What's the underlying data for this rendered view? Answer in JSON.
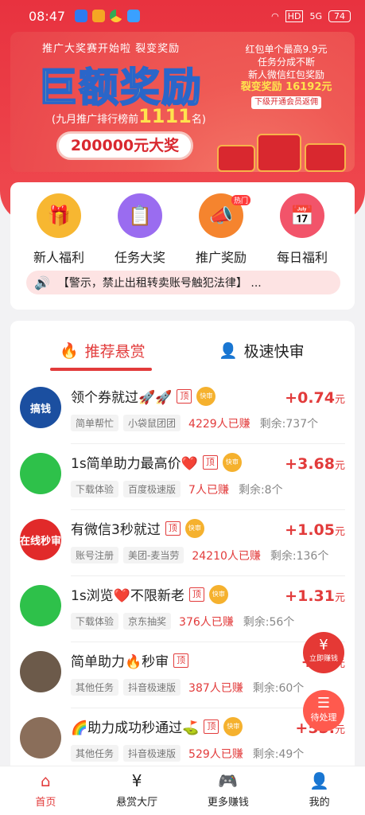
{
  "status": {
    "time": "08:47",
    "icons": [
      "baidu-icon",
      "app-icon",
      "chrome-icon",
      "app2-icon"
    ],
    "battery": "74",
    "hd": "HD",
    "signal": "5G"
  },
  "banner": {
    "promo_line": "推广大奖赛开始啦  裂变奖励",
    "big_title": "巨额奖励",
    "rank_prefix": "(九月推广排行榜前",
    "rank_number": "1111",
    "rank_suffix": "名)",
    "prize": "200000元大奖",
    "right_lines": [
      "红包单个最高9.9元",
      "任务分成不断",
      "新人微信红包奖励"
    ],
    "fission": "裂变奖励 16192元",
    "sub_button": "下级开通会员返佣"
  },
  "menu": {
    "items": [
      {
        "label": "新人福利",
        "icon": "gift-icon",
        "color": "#f7b731"
      },
      {
        "label": "任务大奖",
        "icon": "clipboard-icon",
        "color": "#9a6cf0"
      },
      {
        "label": "推广奖励",
        "icon": "megaphone-icon",
        "color": "#f5842e",
        "badge": "热门"
      },
      {
        "label": "每日福利",
        "icon": "calendar-check-icon",
        "color": "#f2546a"
      }
    ],
    "notice": "【警示，禁止出租转卖账号触犯法律】 ..."
  },
  "tabs": {
    "active": "推荐悬赏",
    "inactive": "极速快审"
  },
  "tasks": [
    {
      "title": "领个券就过🚀🚀",
      "top": "顶",
      "fast": "快审",
      "price_sign": "+",
      "price": "0.74",
      "unit": "元",
      "tags": [
        "简单帮忙",
        "小袋鼠团团"
      ],
      "earned": "4229人已赚",
      "remain": "剩余:737个",
      "avatar_color": "#1b4fa0",
      "avatar_text": "搞钱"
    },
    {
      "title": "1s简单助力最高价❤️",
      "top": "顶",
      "fast": "快审",
      "price_sign": "+",
      "price": "3.68",
      "unit": "元",
      "tags": [
        "下载体验",
        "百度极速版"
      ],
      "earned": "7人已赚",
      "remain": "剩余:8个",
      "avatar_color": "#2ec14a",
      "avatar_text": ""
    },
    {
      "title": "有微信3秒就过",
      "top": "顶",
      "fast": "快审",
      "price_sign": "+",
      "price": "1.05",
      "unit": "元",
      "tags": [
        "账号注册",
        "美团-麦当劳"
      ],
      "earned": "24210人已赚",
      "remain": "剩余:136个",
      "avatar_color": "#e12a2a",
      "avatar_text": "在线秒审"
    },
    {
      "title": "1s浏览❤️不限新老",
      "top": "顶",
      "fast": "快审",
      "price_sign": "+",
      "price": "1.31",
      "unit": "元",
      "tags": [
        "下载体验",
        "京东抽奖"
      ],
      "earned": "376人已赚",
      "remain": "剩余:56个",
      "avatar_color": "#2ec14a",
      "avatar_text": ""
    },
    {
      "title": "简单助力🔥秒审",
      "top": "顶",
      "fast": "",
      "price_sign": "+",
      "price": "55",
      "unit": "元",
      "tags": [
        "其他任务",
        "抖音极速版"
      ],
      "earned": "387人已赚",
      "remain": "剩余:60个",
      "avatar_color": "#6c5a4a",
      "avatar_text": ""
    },
    {
      "title": "🌈助力成功秒通过⛳",
      "top": "顶",
      "fast": "快审",
      "price_sign": "+",
      "price": "55.",
      "unit": "元",
      "tags": [
        "其他任务",
        "抖音极速版"
      ],
      "earned": "529人已赚",
      "remain": "剩余:49个",
      "avatar_color": "#8a6e5a",
      "avatar_text": ""
    }
  ],
  "fabs": {
    "withdraw": "立即赚钱",
    "pending": "待处理"
  },
  "nav": [
    {
      "label": "首页",
      "icon": "home-icon",
      "active": true
    },
    {
      "label": "悬赏大厅",
      "icon": "yen-doc-icon",
      "active": false
    },
    {
      "label": "更多赚钱",
      "icon": "gamepad-icon",
      "active": false
    },
    {
      "label": "我的",
      "icon": "user-icon",
      "active": false
    }
  ]
}
